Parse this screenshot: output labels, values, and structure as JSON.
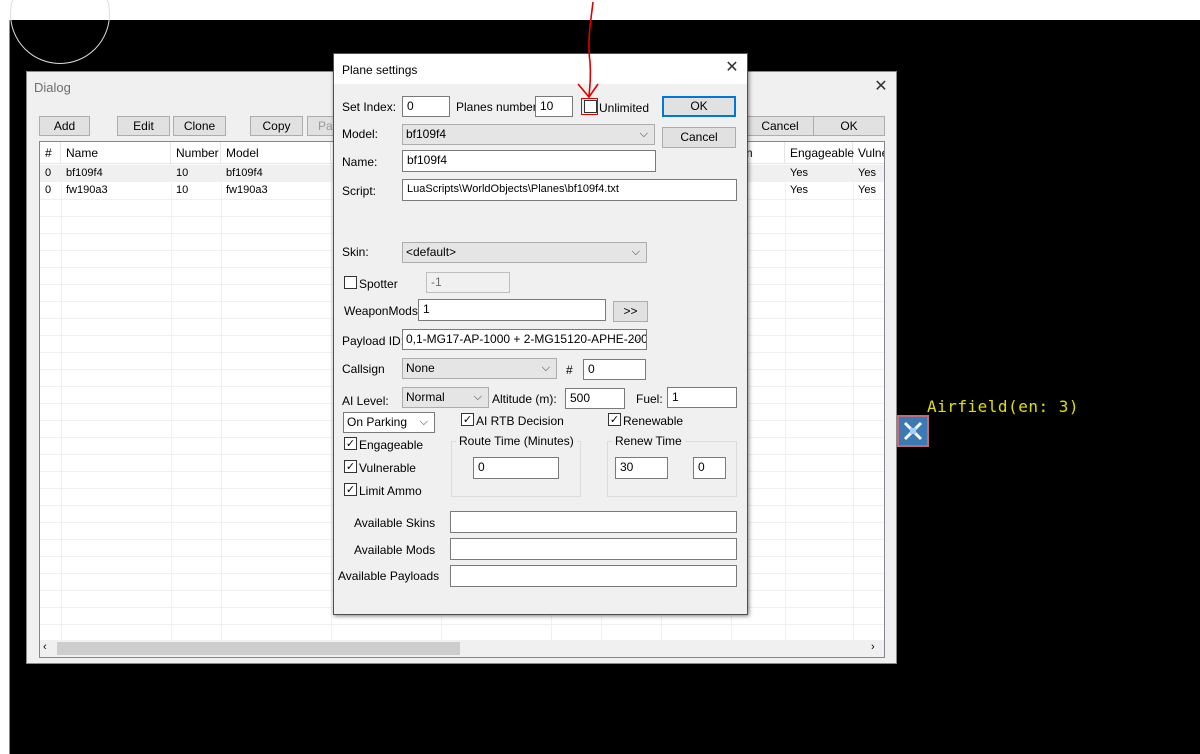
{
  "background": {
    "airfield_label": "Airfield(en: 3)",
    "airfield_icon": "crossed-plane-icon"
  },
  "dialog": {
    "title": "Dialog",
    "buttons": {
      "add": "Add",
      "edit": "Edit",
      "clone": "Clone",
      "copy": "Copy",
      "paste": "Pa",
      "cancel": "Cancel",
      "ok": "OK"
    },
    "table": {
      "columns": [
        "#",
        "Name",
        "Number",
        "Model",
        "um",
        "Engageable",
        "Vulne"
      ],
      "rows": [
        {
          "idx": "0",
          "name": "bf109f4",
          "number": "10",
          "model": "bf109f4",
          "engageable": "Yes",
          "vulnerable": "Yes"
        },
        {
          "idx": "0",
          "name": "fw190a3",
          "number": "10",
          "model": "fw190a3",
          "engageable": "Yes",
          "vulnerable": "Yes"
        }
      ]
    }
  },
  "plane": {
    "title": "Plane settings",
    "ok": "OK",
    "cancel": "Cancel",
    "set_index_label": "Set Index:",
    "set_index": "0",
    "planes_number_label": "Planes number:",
    "planes_number": "10",
    "unlimited_label": "Unlimited",
    "unlimited_checked": false,
    "model_label": "Model:",
    "model": "bf109f4",
    "name_label": "Name:",
    "name": "bf109f4",
    "script_label": "Script:",
    "script": "LuaScripts\\WorldObjects\\Planes\\bf109f4.txt",
    "skin_label": "Skin:",
    "skin": "<default>",
    "spotter_label": "Spotter",
    "spotter_checked": false,
    "spotter_value": "-1",
    "weaponmods_label": "WeaponMods:",
    "weaponmods": "1",
    "weaponmods_button": ">>",
    "payload_label": "Payload ID:",
    "payload": "0,1-MG17-AP-1000 + 2-MG15120-APHE-200",
    "callsign_label": "Callsign",
    "callsign": "None",
    "hash_label": "#",
    "callsign_number": "0",
    "ai_level_label": "AI Level:",
    "ai_level": "Normal",
    "altitude_label": "Altitude (m):",
    "altitude": "500",
    "fuel_label": "Fuel:",
    "fuel": "1",
    "start_mode": "On Parking",
    "ai_rtb_label": "AI RTB Decision",
    "ai_rtb_checked": true,
    "renewable_label": "Renewable",
    "renewable_checked": true,
    "engageable_label": "Engageable",
    "engageable_checked": true,
    "vulnerable_label": "Vulnerable",
    "vulnerable_checked": true,
    "limit_ammo_label": "Limit Ammo",
    "limit_ammo_checked": true,
    "route_time_label": "Route Time (Minutes)",
    "route_time": "0",
    "renew_time_label": "Renew Time",
    "renew_time_1": "30",
    "renew_time_2": "0",
    "available_skins_label": "Available Skins",
    "available_skins": "",
    "available_mods_label": "Available Mods",
    "available_mods": "",
    "available_payloads_label": "Available Payloads",
    "available_payloads": ""
  },
  "colors": {
    "annotation_arrow": "#e00000",
    "airfield_text": "#e0e000",
    "default_button_border": "#0078d7"
  }
}
